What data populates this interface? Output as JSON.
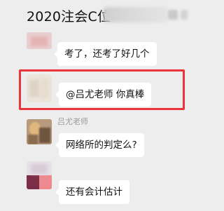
{
  "header": {
    "title": "2020注会C位"
  },
  "messages": [
    {
      "text": "考了，还考了好几个"
    },
    {
      "text": "@吕尤老师 你真棒"
    },
    {
      "sender": "吕尤老师",
      "text": "网络所的判定么?"
    },
    {
      "text": "还有会计估计"
    }
  ],
  "colors": {
    "background": "#ededed",
    "bubble": "#ffffff",
    "highlight": "#e8353b"
  }
}
